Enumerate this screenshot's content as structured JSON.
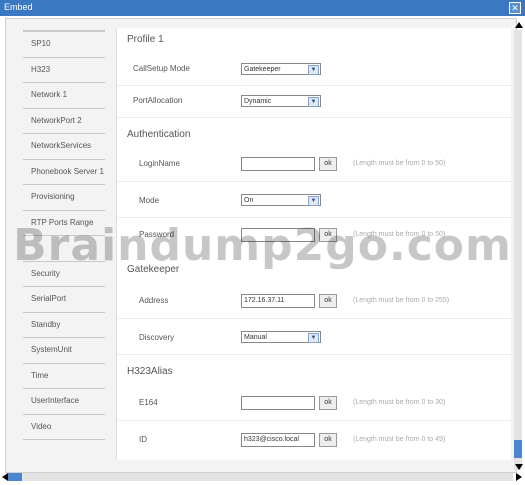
{
  "window": {
    "title": "Embed",
    "close_glyph": "✕"
  },
  "nav": {
    "items": [
      "SP10",
      "H323",
      "Network 1",
      "NetworkPort 2",
      "NetworkServices",
      "Phonebook Server 1",
      "Provisioning",
      "RTP Ports Range",
      "",
      "Security",
      "SerialPort",
      "Standby",
      "SystemUnit",
      "Time",
      "UserInterface",
      "Video"
    ]
  },
  "profile": {
    "heading": "Profile 1",
    "call_setup_mode": {
      "label": "CallSetup Mode",
      "value": "Gatekeeper"
    },
    "port_allocation": {
      "label": "PortAllocation",
      "value": "Dynamic"
    }
  },
  "authentication": {
    "heading": "Authentication",
    "login_name": {
      "label": "LoginName",
      "value": "",
      "ok": "ok",
      "hint": "(Length must be from 0 to 50)"
    },
    "mode": {
      "label": "Mode",
      "value": "On"
    },
    "password": {
      "label": "Password",
      "value": "",
      "ok": "ok",
      "hint": "(Length must be from 0 to 50)"
    }
  },
  "gatekeeper": {
    "heading": "Gatekeeper",
    "address": {
      "label": "Address",
      "value": "172.16.37.11",
      "ok": "ok",
      "hint": "(Length must be from 0 to 255)"
    },
    "discovery": {
      "label": "Discovery",
      "value": "Manual"
    }
  },
  "h323alias": {
    "heading": "H323Alias",
    "e164": {
      "label": "E164",
      "value": "",
      "ok": "ok",
      "hint": "(Length must be from 0 to 30)"
    },
    "id": {
      "label": "ID",
      "value": "h323@cisco.local",
      "ok": "ok",
      "hint": "(Length must be from 0 to 49)"
    }
  },
  "watermark": "Braindump2go.com",
  "icons": {
    "dropdown": "chevron-down-icon"
  },
  "colors": {
    "titlebar": "#3b78c2",
    "accent": "#4a86d0"
  }
}
